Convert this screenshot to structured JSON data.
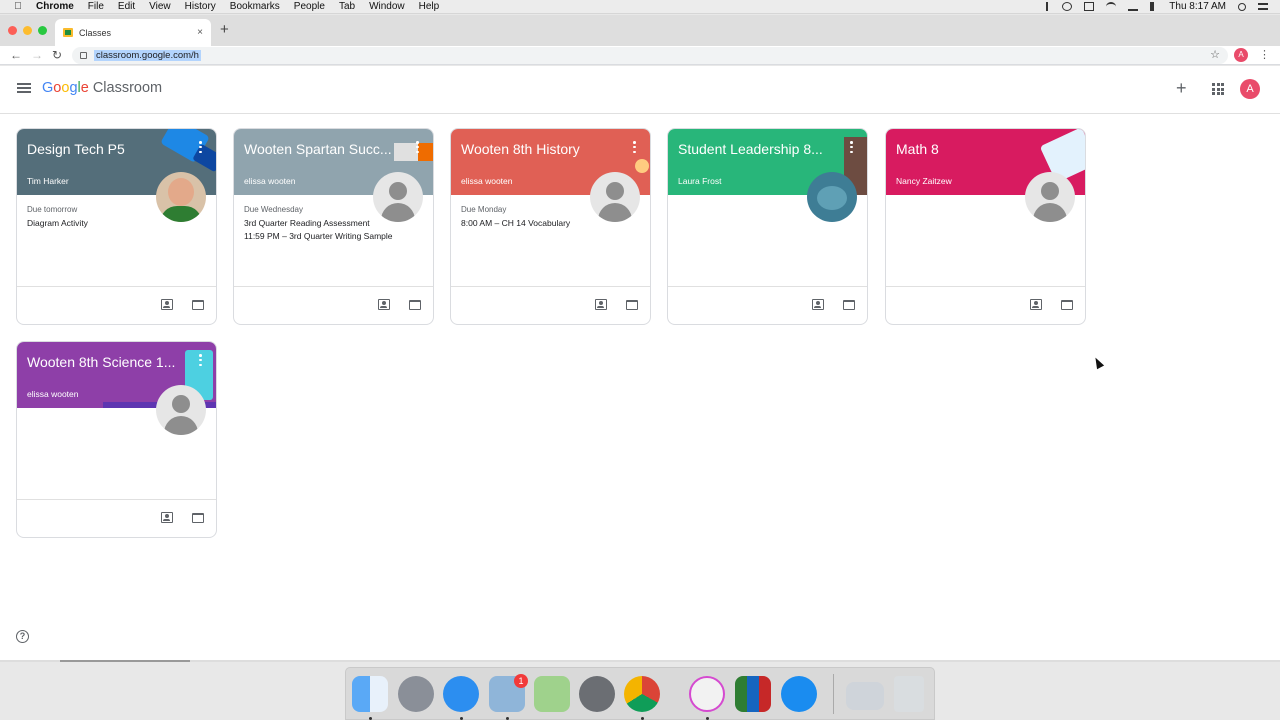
{
  "menubar": {
    "app": "Chrome",
    "items": [
      "File",
      "Edit",
      "View",
      "History",
      "Bookmarks",
      "People",
      "Tab",
      "Window",
      "Help"
    ],
    "clock": "Thu 8:17 AM"
  },
  "browser": {
    "tab_title": "Classes",
    "tab_close": "×",
    "new_tab": "+",
    "url": "classroom.google.com/h",
    "profile_initial": "A"
  },
  "classroom": {
    "logo_letters": [
      "G",
      "o",
      "o",
      "g",
      "l",
      "e"
    ],
    "product": "Classroom",
    "add_label": "+",
    "avatar_initial": "A",
    "help": "?"
  },
  "colors": {
    "design_tech": "#546e7a",
    "spartan": "#90a4ae",
    "history": "#e06055",
    "leadership": "#28b67a",
    "math": "#d81b60",
    "science": "#8e3fa8"
  },
  "classes": [
    {
      "title": "Design Tech P5",
      "teacher": "Tim Harker",
      "due": "Due tomorrow",
      "work": [
        "Diagram Activity"
      ]
    },
    {
      "title": "Wooten Spartan Succ...",
      "teacher": "elissa wooten",
      "due": "Due Wednesday",
      "work": [
        "3rd Quarter Reading Assessment",
        "11:59 PM – 3rd Quarter Writing Sample"
      ]
    },
    {
      "title": "Wooten 8th History",
      "teacher": "elissa wooten",
      "due": "Due Monday",
      "work": [
        "8:00 AM – CH 14 Vocabulary"
      ]
    },
    {
      "title": "Student Leadership 8...",
      "teacher": "Laura Frost",
      "due": "",
      "work": []
    },
    {
      "title": "Math 8",
      "teacher": "Nancy Zaitzew",
      "due": "",
      "work": []
    },
    {
      "title": "Wooten 8th Science 1...",
      "teacher": "elissa wooten",
      "due": "",
      "work": []
    }
  ],
  "dock": {
    "mail_badge": "1"
  }
}
